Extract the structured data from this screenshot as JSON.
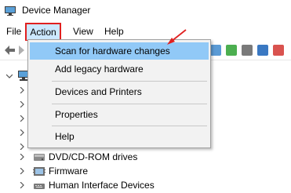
{
  "window": {
    "title": "Device Manager"
  },
  "menubar": {
    "file": "File",
    "action": "Action",
    "view": "View",
    "help": "Help"
  },
  "action_menu": {
    "items": [
      {
        "label": "Scan for hardware changes",
        "highlighted": true
      },
      {
        "label": "Add legacy hardware"
      },
      {
        "label": "Devices and Printers"
      },
      {
        "label": "Properties"
      },
      {
        "label": "Help"
      }
    ]
  },
  "tree": {
    "visible_items": [
      {
        "label": "DVD/CD-ROM drives",
        "icon": "dvd-drive-icon"
      },
      {
        "label": "Firmware",
        "icon": "firmware-icon"
      },
      {
        "label": "Human Interface Devices",
        "icon": "hid-icon"
      }
    ]
  },
  "colors": {
    "menu_highlight": "#91c9f7",
    "menu_background": "#f2f2f2",
    "active_menu_background": "#cce8ff",
    "annotation_red": "#e02020"
  }
}
